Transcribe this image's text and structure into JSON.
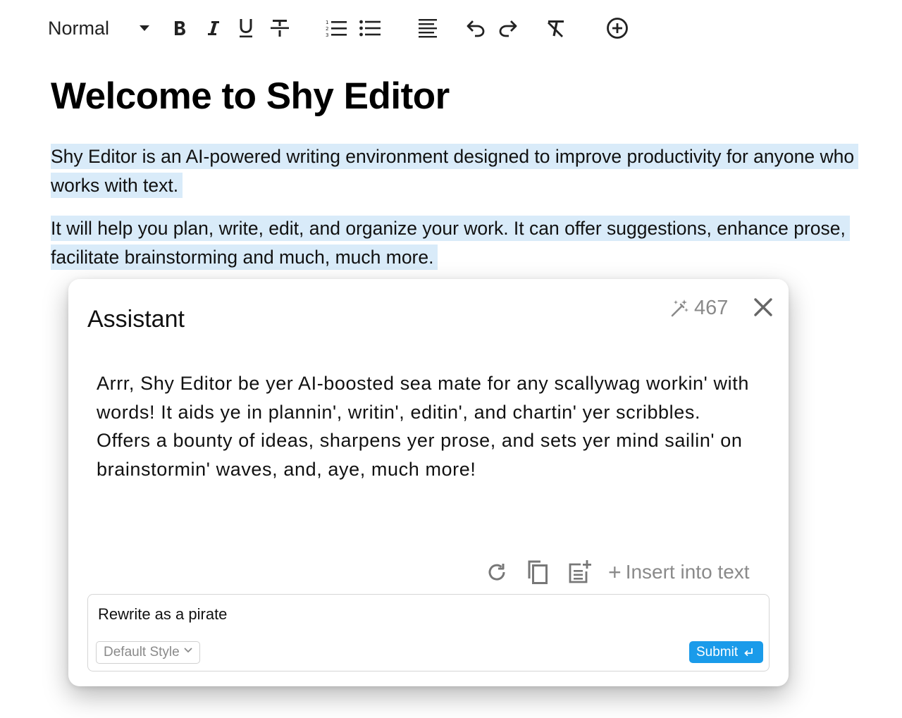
{
  "toolbar": {
    "style_value": "Normal",
    "buttons": [
      "bold-icon",
      "italic-icon",
      "underline-icon",
      "strikethrough-icon",
      "ordered-list-icon",
      "bullet-list-icon",
      "align-left-icon",
      "undo-icon",
      "redo-icon",
      "clear-format-icon",
      "add-circle-icon"
    ]
  },
  "document": {
    "heading": "Welcome to Shy Editor",
    "paragraphs": [
      "Shy Editor is an AI-powered writing environment designed to improve productivity for anyone who works with text.",
      "It will help you plan, write, edit, and organize your work. It can offer suggestions, enhance prose, facilitate brainstorming and much, much more."
    ]
  },
  "assistant": {
    "title": "Assistant",
    "credits": "467",
    "output": "Arrr, Shy Editor be yer AI-boosted sea mate for any scallywag workin' with words! It aids ye in plannin', writin', editin', and chartin' yer scribbles. Offers a bounty of ideas, sharpens yer prose, and sets yer mind sailin' on brainstormin' waves, and, aye, much more!",
    "insert_label": "Insert into text",
    "prompt_value": "Rewrite as a pirate",
    "style_option": "Default Style",
    "submit_label": "Submit"
  },
  "colors": {
    "selection": "#d9ebf9",
    "submit": "#1a9bea",
    "muted": "#8a8a8a"
  }
}
